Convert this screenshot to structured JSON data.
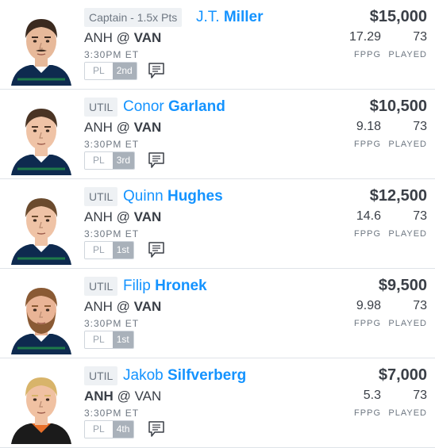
{
  "players": [
    {
      "position": "Captain - 1.5x Pts",
      "first_name": "J.T.",
      "last_name": "Miller",
      "away": "ANH",
      "at": "@",
      "home": "VAN",
      "bold_team": "home",
      "time": "3:30PM ET",
      "pl_label": "PL",
      "pl_rank": "2nd",
      "has_news": true,
      "salary": "$15,000",
      "fppg": "17.29",
      "fppg_label": "FPPG",
      "played": "73",
      "played_label": "PLAYED",
      "avatar": {
        "jersey": "#0e2a4f",
        "hair": "#3b2a1f",
        "skin": "#e7b99a",
        "mustache": true
      }
    },
    {
      "position": "UTIL",
      "first_name": "Conor",
      "last_name": "Garland",
      "away": "ANH",
      "at": "@",
      "home": "VAN",
      "bold_team": "home",
      "time": "3:30PM ET",
      "pl_label": "PL",
      "pl_rank": "3rd",
      "has_news": true,
      "salary": "$10,500",
      "fppg": "9.18",
      "fppg_label": "FPPG",
      "played": "73",
      "played_label": "PLAYED",
      "avatar": {
        "jersey": "#0e2a4f",
        "hair": "#4a3424",
        "skin": "#efc3a6",
        "mustache": false
      }
    },
    {
      "position": "UTIL",
      "first_name": "Quinn",
      "last_name": "Hughes",
      "away": "ANH",
      "at": "@",
      "home": "VAN",
      "bold_team": "home",
      "time": "3:30PM ET",
      "pl_label": "PL",
      "pl_rank": "1st",
      "has_news": true,
      "salary": "$12,500",
      "fppg": "14.6",
      "fppg_label": "FPPG",
      "played": "73",
      "played_label": "PLAYED",
      "avatar": {
        "jersey": "#0e2a4f",
        "hair": "#6b4b2e",
        "skin": "#efc3a6",
        "mustache": false
      }
    },
    {
      "position": "UTIL",
      "first_name": "Filip",
      "last_name": "Hronek",
      "away": "ANH",
      "at": "@",
      "home": "VAN",
      "bold_team": "home",
      "time": "3:30PM ET",
      "pl_label": "PL",
      "pl_rank": "1st",
      "has_news": false,
      "salary": "$9,500",
      "fppg": "9.98",
      "fppg_label": "FPPG",
      "played": "73",
      "played_label": "PLAYED",
      "avatar": {
        "jersey": "#0e2a4f",
        "hair": "#8a5a34",
        "skin": "#e9b496",
        "beard": true
      }
    },
    {
      "position": "UTIL",
      "first_name": "Jakob",
      "last_name": "Silfverberg",
      "away": "ANH",
      "at": "@",
      "home": "VAN",
      "bold_team": "away",
      "time": "3:30PM ET",
      "pl_label": "PL",
      "pl_rank": "4th",
      "has_news": true,
      "salary": "$7,000",
      "fppg": "5.3",
      "fppg_label": "FPPG",
      "played": "73",
      "played_label": "PLAYED",
      "avatar": {
        "jersey": "#1b1b1b",
        "hair": "#d8b46a",
        "skin": "#f0c1a2",
        "mustache": false,
        "orange_collar": true
      }
    }
  ]
}
